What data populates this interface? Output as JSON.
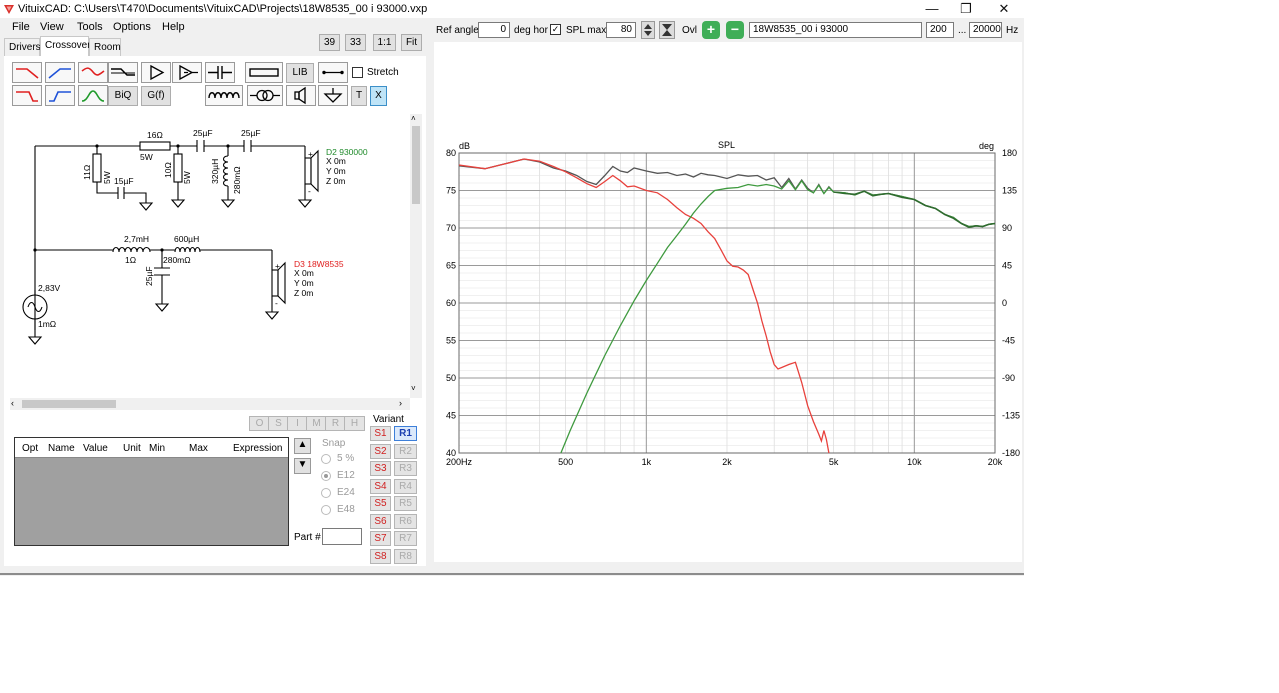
{
  "window": {
    "title": "VituixCAD: C:\\Users\\T470\\Documents\\VituixCAD\\Projects\\18W8535_00 i 93000.vxp",
    "minimize": "—",
    "maximize": "❐",
    "close": "✕"
  },
  "menu": [
    "File",
    "View",
    "Tools",
    "Options",
    "Help"
  ],
  "tabs": [
    "Drivers",
    "Crossover",
    "Room"
  ],
  "zoom_buttons": [
    "39",
    "33",
    "1:1",
    "Fit"
  ],
  "toolbar": {
    "lib": "LIB",
    "stretch": "Stretch",
    "biq": "BiQ",
    "gf": "G(f)",
    "t": "T",
    "x": "X"
  },
  "schematic": {
    "r16": "16Ω",
    "r16w": "5W",
    "c25a": "25µF",
    "c25b": "25µF",
    "r11": "11Ω",
    "r11w": "5W",
    "c15": "15µF",
    "r10": "10Ω",
    "r10w": "5W",
    "l320": "320µH",
    "l320r": "280mΩ",
    "d2": "D2 930000",
    "d2x": "X 0m",
    "d2y": "Y 0m",
    "d2z": "Z 0m",
    "l27": "2,7mH",
    "l27r": "1Ω",
    "l600": "600µH",
    "l600r": "280mΩ",
    "c25c": "25µF",
    "d3": "D3 18W8535",
    "d3x": "X 0m",
    "d3y": "Y 0m",
    "d3z": "Z 0m",
    "src_v": "2,83V",
    "src_r": "1mΩ",
    "plus": "+",
    "minus": "-"
  },
  "opt_buttons": [
    "O",
    "S",
    "I",
    "M",
    "R",
    "H"
  ],
  "param_table": {
    "columns": [
      "Opt",
      "Name",
      "Value",
      "Unit",
      "Min",
      "Max",
      "Expression"
    ]
  },
  "snap": {
    "label": "Snap",
    "options": [
      "5 %",
      "E12",
      "E24",
      "E48"
    ],
    "selected": "E12"
  },
  "part_label": "Part #",
  "variant": {
    "label": "Variant",
    "s": [
      "S1",
      "S2",
      "S3",
      "S4",
      "S5",
      "S6",
      "S7",
      "S8"
    ],
    "r": [
      "R1",
      "R2",
      "R3",
      "R4",
      "R5",
      "R6",
      "R7",
      "R8"
    ],
    "active_r": "R1"
  },
  "topbar": {
    "ref_angle_label": "Ref angle",
    "ref_angle_value": "0",
    "deg_hor": "deg hor",
    "spl_max_label": "SPL max",
    "spl_max_checked": true,
    "spl_max_value": "80",
    "ovl": "Ovl",
    "plus": "+",
    "minus": "−",
    "name_value": "18W8535_00 i 93000",
    "fmin": "200",
    "dots": "...",
    "fmax": "20000",
    "hz": "Hz"
  },
  "chart_data": {
    "type": "line",
    "title": "SPL",
    "ylabel_left": "dB",
    "ylabel_right": "deg",
    "xscale": "log",
    "xlim": [
      200,
      20000
    ],
    "ylim": [
      40,
      80
    ],
    "ylim_right": [
      -180,
      180
    ],
    "x_ticks": [
      {
        "v": 200,
        "label": "200Hz"
      },
      {
        "v": 500,
        "label": "500"
      },
      {
        "v": 1000,
        "label": "1k"
      },
      {
        "v": 2000,
        "label": "2k"
      },
      {
        "v": 5000,
        "label": "5k"
      },
      {
        "v": 10000,
        "label": "10k"
      },
      {
        "v": 20000,
        "label": "20k"
      }
    ],
    "y_ticks": [
      {
        "v": 80,
        "label": "80"
      },
      {
        "v": 75,
        "label": "75"
      },
      {
        "v": 70,
        "label": "70"
      },
      {
        "v": 65,
        "label": "65"
      },
      {
        "v": 60,
        "label": "60"
      },
      {
        "v": 55,
        "label": "55"
      },
      {
        "v": 50,
        "label": "50"
      },
      {
        "v": 45,
        "label": "45"
      },
      {
        "v": 40,
        "label": "40"
      }
    ],
    "y_ticks_right": [
      "180",
      "135",
      "90",
      "45",
      "0",
      "-45",
      "-90",
      "-135",
      "-180"
    ],
    "grid": true,
    "series": [
      {
        "color": "#555555",
        "points": [
          [
            200,
            78.3
          ],
          [
            250,
            77.9
          ],
          [
            300,
            78.6
          ],
          [
            350,
            79.2
          ],
          [
            400,
            78.8
          ],
          [
            450,
            78.0
          ],
          [
            500,
            77.6
          ],
          [
            550,
            77.0
          ],
          [
            600,
            76.2
          ],
          [
            650,
            75.8
          ],
          [
            700,
            77.0
          ],
          [
            750,
            78.2
          ],
          [
            800,
            77.6
          ],
          [
            850,
            77.4
          ],
          [
            900,
            78.0
          ],
          [
            1000,
            77.6
          ],
          [
            1100,
            77.3
          ],
          [
            1200,
            77.4
          ],
          [
            1300,
            77.0
          ],
          [
            1400,
            77.2
          ],
          [
            1500,
            76.8
          ],
          [
            1600,
            77.3
          ],
          [
            1700,
            77.1
          ],
          [
            1800,
            77.0
          ],
          [
            2000,
            76.6
          ],
          [
            2200,
            77.1
          ],
          [
            2400,
            76.9
          ],
          [
            2600,
            77.0
          ],
          [
            2800,
            76.4
          ],
          [
            3000,
            76.7
          ],
          [
            3200,
            75.4
          ],
          [
            3400,
            76.6
          ],
          [
            3600,
            75.2
          ],
          [
            3800,
            76.4
          ],
          [
            4000,
            75.3
          ],
          [
            4200,
            74.7
          ],
          [
            4400,
            75.8
          ],
          [
            4600,
            74.6
          ],
          [
            4800,
            75.5
          ],
          [
            5000,
            74.8
          ],
          [
            5500,
            74.7
          ],
          [
            6000,
            74.4
          ],
          [
            6500,
            74.9
          ],
          [
            7000,
            74.4
          ],
          [
            7500,
            74.5
          ],
          [
            8000,
            74.6
          ],
          [
            9000,
            74.2
          ],
          [
            10000,
            73.8
          ],
          [
            11000,
            73.0
          ],
          [
            12000,
            72.6
          ],
          [
            13000,
            71.8
          ],
          [
            14000,
            71.4
          ],
          [
            15000,
            70.6
          ],
          [
            16000,
            70.2
          ],
          [
            17000,
            70.3
          ],
          [
            18000,
            70.2
          ],
          [
            19000,
            70.5
          ],
          [
            20000,
            70.6
          ]
        ]
      },
      {
        "color": "#e8413c",
        "points": [
          [
            200,
            78.4
          ],
          [
            250,
            77.9
          ],
          [
            300,
            78.6
          ],
          [
            350,
            79.2
          ],
          [
            400,
            78.9
          ],
          [
            450,
            78.2
          ],
          [
            500,
            77.5
          ],
          [
            550,
            76.7
          ],
          [
            600,
            75.9
          ],
          [
            650,
            75.4
          ],
          [
            700,
            76.2
          ],
          [
            750,
            77.0
          ],
          [
            800,
            76.3
          ],
          [
            850,
            75.5
          ],
          [
            900,
            75.6
          ],
          [
            1000,
            75.0
          ],
          [
            1100,
            74.7
          ],
          [
            1200,
            73.8
          ],
          [
            1300,
            72.7
          ],
          [
            1400,
            71.8
          ],
          [
            1500,
            71.3
          ],
          [
            1600,
            70.6
          ],
          [
            1700,
            69.5
          ],
          [
            1800,
            68.6
          ],
          [
            1900,
            67.1
          ],
          [
            2000,
            65.6
          ],
          [
            2100,
            64.9
          ],
          [
            2200,
            64.8
          ],
          [
            2300,
            64.4
          ],
          [
            2400,
            63.8
          ],
          [
            2500,
            61.8
          ],
          [
            2600,
            60.0
          ],
          [
            2700,
            57.6
          ],
          [
            2800,
            55.6
          ],
          [
            2900,
            53.5
          ],
          [
            3000,
            51.8
          ],
          [
            3100,
            51.2
          ],
          [
            3200,
            51.4
          ],
          [
            3400,
            51.8
          ],
          [
            3600,
            52.1
          ],
          [
            3800,
            49.4
          ],
          [
            4000,
            46.3
          ],
          [
            4200,
            44.2
          ],
          [
            4400,
            42.5
          ],
          [
            4500,
            41.6
          ],
          [
            4600,
            43.0
          ],
          [
            4700,
            41.8
          ],
          [
            4800,
            40.0
          ]
        ]
      },
      {
        "color": "#3f9a3f",
        "points": [
          [
            480,
            40.0
          ],
          [
            520,
            43.0
          ],
          [
            600,
            48.0
          ],
          [
            700,
            53.0
          ],
          [
            800,
            57.0
          ],
          [
            900,
            60.3
          ],
          [
            1000,
            63.0
          ],
          [
            1100,
            65.3
          ],
          [
            1200,
            67.4
          ],
          [
            1300,
            69.0
          ],
          [
            1400,
            70.5
          ],
          [
            1500,
            72.0
          ],
          [
            1600,
            73.2
          ],
          [
            1700,
            74.2
          ],
          [
            1800,
            75.0
          ],
          [
            2000,
            75.3
          ],
          [
            2200,
            75.4
          ],
          [
            2400,
            75.8
          ],
          [
            2600,
            75.6
          ],
          [
            2800,
            75.8
          ],
          [
            3000,
            75.6
          ],
          [
            3200,
            75.2
          ],
          [
            3400,
            76.3
          ],
          [
            3600,
            75.1
          ],
          [
            3800,
            76.3
          ],
          [
            4000,
            75.1
          ],
          [
            4200,
            74.7
          ],
          [
            4400,
            75.7
          ],
          [
            4600,
            74.6
          ],
          [
            4800,
            75.4
          ],
          [
            5000,
            74.8
          ],
          [
            5500,
            74.7
          ],
          [
            6000,
            74.4
          ],
          [
            6500,
            74.9
          ],
          [
            7000,
            74.4
          ],
          [
            7500,
            74.5
          ],
          [
            8000,
            74.6
          ],
          [
            9000,
            74.2
          ],
          [
            10000,
            73.8
          ],
          [
            11000,
            73.0
          ],
          [
            12000,
            72.6
          ],
          [
            13000,
            71.8
          ],
          [
            14000,
            71.4
          ],
          [
            15000,
            70.6
          ],
          [
            16000,
            70.2
          ],
          [
            17000,
            70.3
          ],
          [
            18000,
            70.2
          ],
          [
            19000,
            70.5
          ],
          [
            20000,
            70.6
          ]
        ]
      },
      {
        "color": "#2f6b2f",
        "points": [
          [
            5000,
            74.8
          ],
          [
            5500,
            74.6
          ],
          [
            6000,
            74.5
          ],
          [
            6500,
            74.9
          ],
          [
            7000,
            74.3
          ],
          [
            7500,
            74.5
          ],
          [
            8000,
            74.6
          ],
          [
            9000,
            74.1
          ],
          [
            10000,
            73.8
          ],
          [
            11000,
            73.0
          ],
          [
            12000,
            72.6
          ],
          [
            13000,
            71.8
          ],
          [
            14000,
            71.3
          ],
          [
            15000,
            70.6
          ],
          [
            16000,
            70.1
          ],
          [
            17000,
            70.3
          ],
          [
            18000,
            70.2
          ],
          [
            19000,
            70.5
          ],
          [
            20000,
            70.6
          ]
        ]
      }
    ]
  }
}
